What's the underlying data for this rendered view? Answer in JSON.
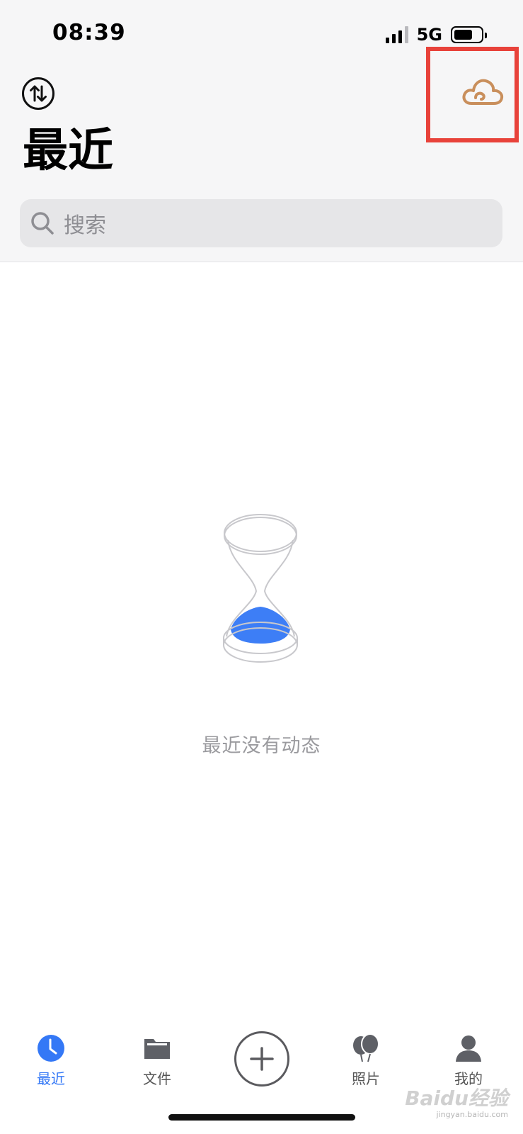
{
  "status_bar": {
    "time": "08:39",
    "network": "5G",
    "icons": [
      "signal-icon",
      "battery-icon"
    ]
  },
  "header": {
    "sort_icon": "sort-arrows-icon",
    "cloud_icon": "cloud-icon",
    "title": "最近",
    "highlight_color": "#e8423a"
  },
  "search": {
    "placeholder": "搜索",
    "icon": "search-icon"
  },
  "empty_state": {
    "icon": "hourglass-icon",
    "message": "最近没有动态",
    "accent_color": "#3d7ef6"
  },
  "tab_bar": {
    "active_color": "#3478f6",
    "items": [
      {
        "label": "最近",
        "icon": "clock-icon",
        "active": true
      },
      {
        "label": "文件",
        "icon": "folder-icon",
        "active": false
      },
      {
        "label": "",
        "icon": "plus-icon",
        "active": false
      },
      {
        "label": "照片",
        "icon": "balloon-icon",
        "active": false
      },
      {
        "label": "我的",
        "icon": "person-icon",
        "active": false
      }
    ]
  },
  "watermark": {
    "text": "Baidu经验",
    "subtext": "jingyan.baidu.com"
  }
}
